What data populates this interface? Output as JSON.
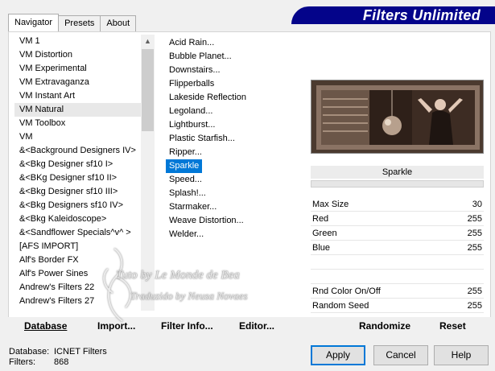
{
  "tabs": [
    {
      "label": "Navigator",
      "active": true
    },
    {
      "label": "Presets",
      "active": false
    },
    {
      "label": "About",
      "active": false
    }
  ],
  "banner": {
    "title": "Filters Unlimited"
  },
  "categories": [
    "VM 1",
    "VM Distortion",
    "VM Experimental",
    "VM Extravaganza",
    "VM Instant Art",
    "VM Natural",
    "VM Toolbox",
    "VM",
    "&<Background Designers IV>",
    "&<Bkg Designer sf10 I>",
    "&<BKg Designer sf10 II>",
    "&<Bkg Designer sf10 III>",
    "&<Bkg Designers sf10 IV>",
    "&<Bkg Kaleidoscope>",
    "&<Sandflower Specials^v^ >",
    "[AFS IMPORT]",
    "Alf's Border FX",
    "Alf's Power Sines",
    "Andrew's Filters 22",
    "Andrew's Filters 27"
  ],
  "selected_category": "VM Natural",
  "filters": [
    "Acid Rain...",
    "Bubble Planet...",
    "Downstairs...",
    "Flipperballs",
    "Lakeside Reflection",
    "Legoland...",
    "Lightburst...",
    "Plastic Starfish...",
    "Ripper...",
    "Sparkle",
    "Speed...",
    "Splash!...",
    "Starmaker...",
    "Weave Distortion...",
    "Welder..."
  ],
  "selected_filter": "Sparkle",
  "filter_name": "Sparkle",
  "params": [
    {
      "name": "Max Size",
      "value": "30"
    },
    {
      "name": "Red",
      "value": "255"
    },
    {
      "name": "Green",
      "value": "255"
    },
    {
      "name": "Blue",
      "value": "255"
    },
    {
      "name": "",
      "value": ""
    },
    {
      "name": "",
      "value": ""
    },
    {
      "name": "Rnd Color On/Off",
      "value": "255"
    },
    {
      "name": "Random Seed",
      "value": "255"
    }
  ],
  "bottom_buttons": {
    "database": "Database",
    "import": "Import...",
    "filter_info": "Filter Info...",
    "editor": "Editor...",
    "randomize": "Randomize",
    "reset": "Reset"
  },
  "status": {
    "database_label": "Database:",
    "database_value": "ICNET Filters",
    "filters_label": "Filters:",
    "filters_value": "868"
  },
  "dialog_buttons": {
    "apply": "Apply",
    "cancel": "Cancel",
    "help": "Help"
  },
  "watermark": {
    "line1": "Tuto by Le Monde de Bea",
    "line2": "Traduzido by Neusa Novaes"
  },
  "colors": {
    "banner": "#04048a",
    "selection": "#0078d7",
    "preview_bg": "#3a2a22"
  }
}
